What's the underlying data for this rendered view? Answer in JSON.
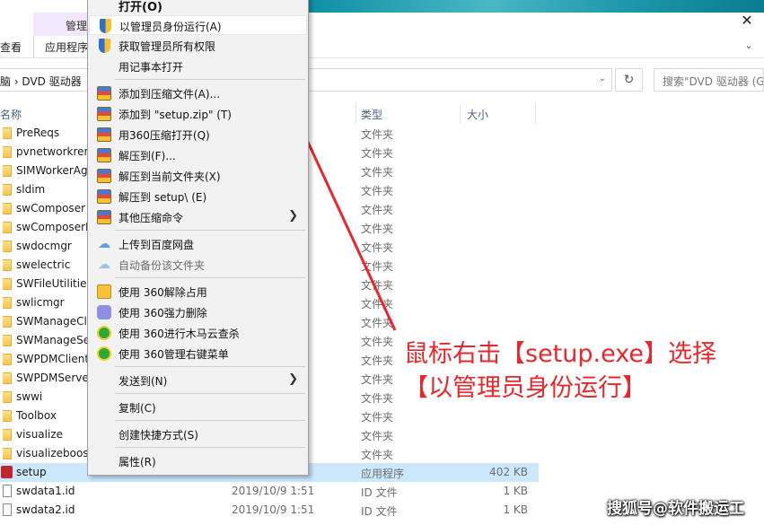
{
  "ribbon": {
    "manage_tab": "管理",
    "view_tab": "查看",
    "app_tools_tab": "应用程序",
    "close_glyph": "✕"
  },
  "address": {
    "path": "脑 › DVD 驱动器",
    "search_placeholder": "搜索\"DVD 驱动器 (G"
  },
  "columns": {
    "name": "名称",
    "type": "类型",
    "size": "大小"
  },
  "files": [
    {
      "name": "PreReqs",
      "date": "",
      "type": "文件夹",
      "size": "",
      "kind": "folder"
    },
    {
      "name": "pvnetworkren",
      "date": "",
      "type": "文件夹",
      "size": "",
      "kind": "folder"
    },
    {
      "name": "SIMWorkerAg",
      "date": "",
      "type": "文件夹",
      "size": "",
      "kind": "folder"
    },
    {
      "name": "sldim",
      "date": "",
      "type": "文件夹",
      "size": "",
      "kind": "folder"
    },
    {
      "name": "swComposer",
      "date": "",
      "type": "文件夹",
      "size": "",
      "kind": "folder"
    },
    {
      "name": "swComposerP",
      "date": "",
      "type": "文件夹",
      "size": "",
      "kind": "folder"
    },
    {
      "name": "swdocmgr",
      "date": "",
      "type": "文件夹",
      "size": "",
      "kind": "folder"
    },
    {
      "name": "swelectric",
      "date": "",
      "type": "文件夹",
      "size": "",
      "kind": "folder"
    },
    {
      "name": "SWFileUtilities",
      "date": "",
      "type": "文件夹",
      "size": "",
      "kind": "folder"
    },
    {
      "name": "swlicmgr",
      "date": "",
      "type": "文件夹",
      "size": "",
      "kind": "folder"
    },
    {
      "name": "SWManageCl",
      "date": "",
      "type": "文件夹",
      "size": "",
      "kind": "folder"
    },
    {
      "name": "SWManageSe",
      "date": "",
      "type": "文件夹",
      "size": "",
      "kind": "folder"
    },
    {
      "name": "SWPDMClient",
      "date": "",
      "type": "文件夹",
      "size": "",
      "kind": "folder"
    },
    {
      "name": "SWPDMServe",
      "date": "",
      "type": "文件夹",
      "size": "",
      "kind": "folder"
    },
    {
      "name": "swwi",
      "date": "",
      "type": "文件夹",
      "size": "",
      "kind": "folder"
    },
    {
      "name": "Toolbox",
      "date": "",
      "type": "文件夹",
      "size": "",
      "kind": "folder"
    },
    {
      "name": "visualize",
      "date": "",
      "type": "文件夹",
      "size": "",
      "kind": "folder"
    },
    {
      "name": "visualizeboos",
      "date": "",
      "type": "文件夹",
      "size": "",
      "kind": "folder"
    },
    {
      "name": "setup",
      "date": "",
      "type": "应用程序",
      "size": "402 KB",
      "kind": "setup"
    },
    {
      "name": "swdata1.id",
      "date": "2019/10/9 1:51",
      "type": "ID 文件",
      "size": "1 KB",
      "kind": "file"
    },
    {
      "name": "swdata2.id",
      "date": "2019/10/9 1:51",
      "type": "ID 文件",
      "size": "1 KB",
      "kind": "file"
    }
  ],
  "context_menu": {
    "open": "打开(O)",
    "run_as_admin": "以管理员身份运行(A)",
    "take_ownership": "获取管理员所有权限",
    "open_with_notepad": "用记事本打开",
    "add_to_archive": "添加到压缩文件(A)...",
    "add_to_setup_zip": "添加到 \"setup.zip\" (T)",
    "open_with_360zip": "用360压缩打开(Q)",
    "extract_to": "解压到(F)...",
    "extract_here": "解压到当前文件夹(X)",
    "extract_to_setup": "解压到 setup\\ (E)",
    "other_compress": "其他压缩命令",
    "upload_baidu": "上传到百度网盘",
    "auto_backup": "自动备份该文件夹",
    "unlock_360": "使用 360解除占用",
    "force_delete_360": "使用 360强力删除",
    "trojan_scan_360": "使用 360进行木马云查杀",
    "manage_menu_360": "使用 360管理右键菜单",
    "send_to": "发送到(N)",
    "copy": "复制(C)",
    "create_shortcut": "创建快捷方式(S)",
    "properties": "属性(R)",
    "submenu_arrow": "❯"
  },
  "annotation": {
    "line1": "鼠标右击【setup.exe】选择",
    "line2": "【以管理员身份运行】",
    "color": "#e8262b"
  },
  "watermark": "搜狐号@软件搬运工"
}
